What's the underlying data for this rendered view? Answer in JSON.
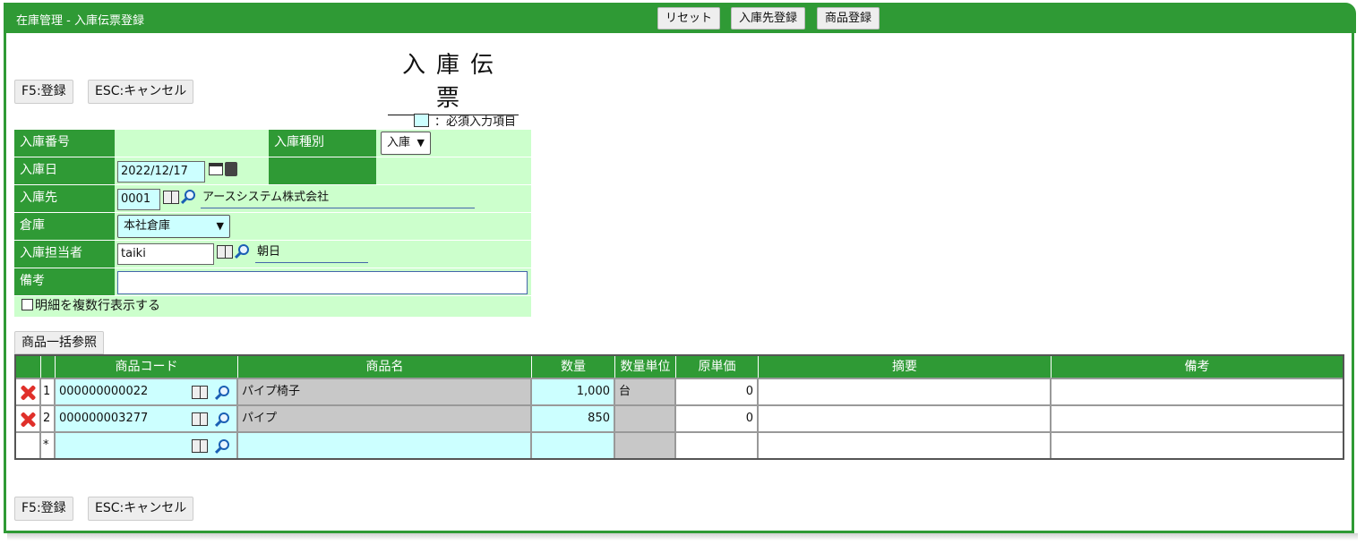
{
  "app": {
    "title": "在庫管理 - 入庫伝票登録"
  },
  "top_buttons": {
    "reset": "リセット",
    "supplier_register": "入庫先登録",
    "product_register": "商品登録"
  },
  "heading": "入庫伝票",
  "actions": {
    "register": "F5:登録",
    "cancel": "ESC:キャンセル"
  },
  "legend": {
    "text": "：必須入力項目"
  },
  "form": {
    "receipt_no_label": "入庫番号",
    "receipt_type_label": "入庫種別",
    "receipt_type_value": "入庫",
    "date_label": "入庫日",
    "date_value": "2022/12/17",
    "supplier_label": "入庫先",
    "supplier_code": "0001",
    "supplier_name": "アースシステム株式会社",
    "warehouse_label": "倉庫",
    "warehouse_value": "本社倉庫",
    "staff_label": "入庫担当者",
    "staff_code": "taiki",
    "staff_name": "朝日",
    "remarks_label": "備考",
    "remarks_value": "",
    "multiline_label": "明細を複数行表示する"
  },
  "bulk_ref_button": "商品一括参照",
  "table": {
    "headers": [
      "",
      "",
      "商品コード",
      "商品名",
      "数量",
      "数量単位",
      "原単価",
      "摘要",
      "備考"
    ],
    "rows": [
      {
        "no": "1",
        "code": "000000000022",
        "name": "パイプ椅子",
        "qty": "1,000",
        "unit": "台",
        "cost": "0",
        "summary": "",
        "note": ""
      },
      {
        "no": "2",
        "code": "000000003277",
        "name": "パイプ",
        "qty": "850",
        "unit": "",
        "cost": "0",
        "summary": "",
        "note": ""
      },
      {
        "no": "*",
        "code": "",
        "name": "",
        "qty": "",
        "unit": "",
        "cost": "",
        "summary": "",
        "note": ""
      }
    ]
  },
  "colors": {
    "accent": "#2f9a35",
    "required_bg": "#ccffff",
    "form_bg": "#ccffcc",
    "readonly_bg": "#c8c8c8"
  }
}
